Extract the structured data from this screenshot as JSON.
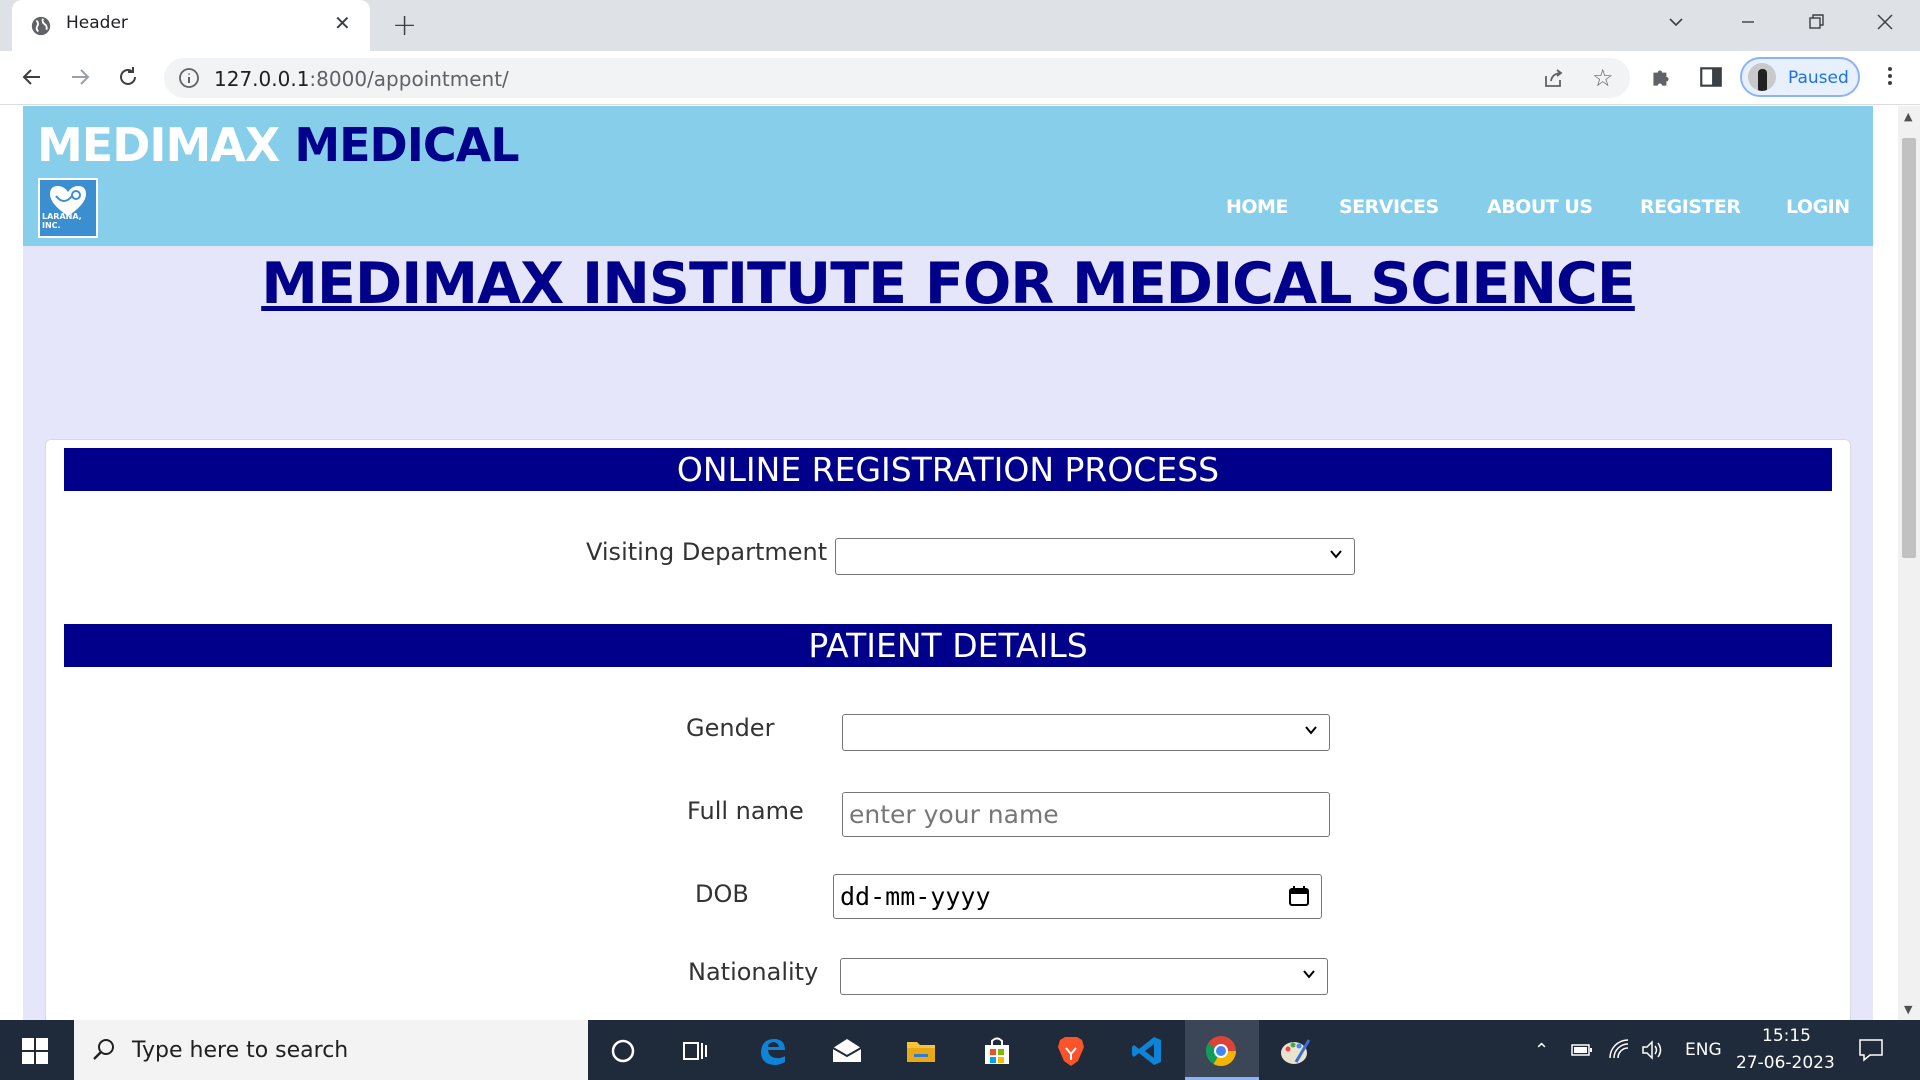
{
  "browser": {
    "tab_title": "Header",
    "url_host": "127.0.0.1",
    "url_path": ":8000/appointment/",
    "profile_label": "Paused"
  },
  "site": {
    "brand_part1": "MEDIMAX",
    "brand_part2": "MEDICAL",
    "logo_text": "LARANA, INC.",
    "nav": [
      "HOME",
      "SERVICES",
      "ABOUT US",
      "REGISTER",
      "LOGIN"
    ],
    "main_title": "MEDIMAX INSTITUTE FOR MEDICAL SCIENCE"
  },
  "form": {
    "section1_title": "ONLINE REGISTRATION PROCESS",
    "visiting_department_label": "Visiting Department",
    "visiting_department_value": "",
    "section2_title": "PATIENT DETAILS",
    "gender_label": "Gender",
    "gender_value": "",
    "fullname_label": "Full name",
    "fullname_placeholder": "enter your name",
    "dob_label": "DOB",
    "dob_placeholder": "dd-mm-yyyy",
    "nationality_label": "Nationality",
    "nationality_value": ""
  },
  "taskbar": {
    "search_placeholder": "Type here to search",
    "language": "ENG",
    "time": "15:15",
    "date": "27-06-2023"
  },
  "colors": {
    "header_bg": "#87ceeb",
    "brand_dark": "#00008b",
    "page_bg": "#e6e6fa",
    "section_bar": "#00008b"
  }
}
